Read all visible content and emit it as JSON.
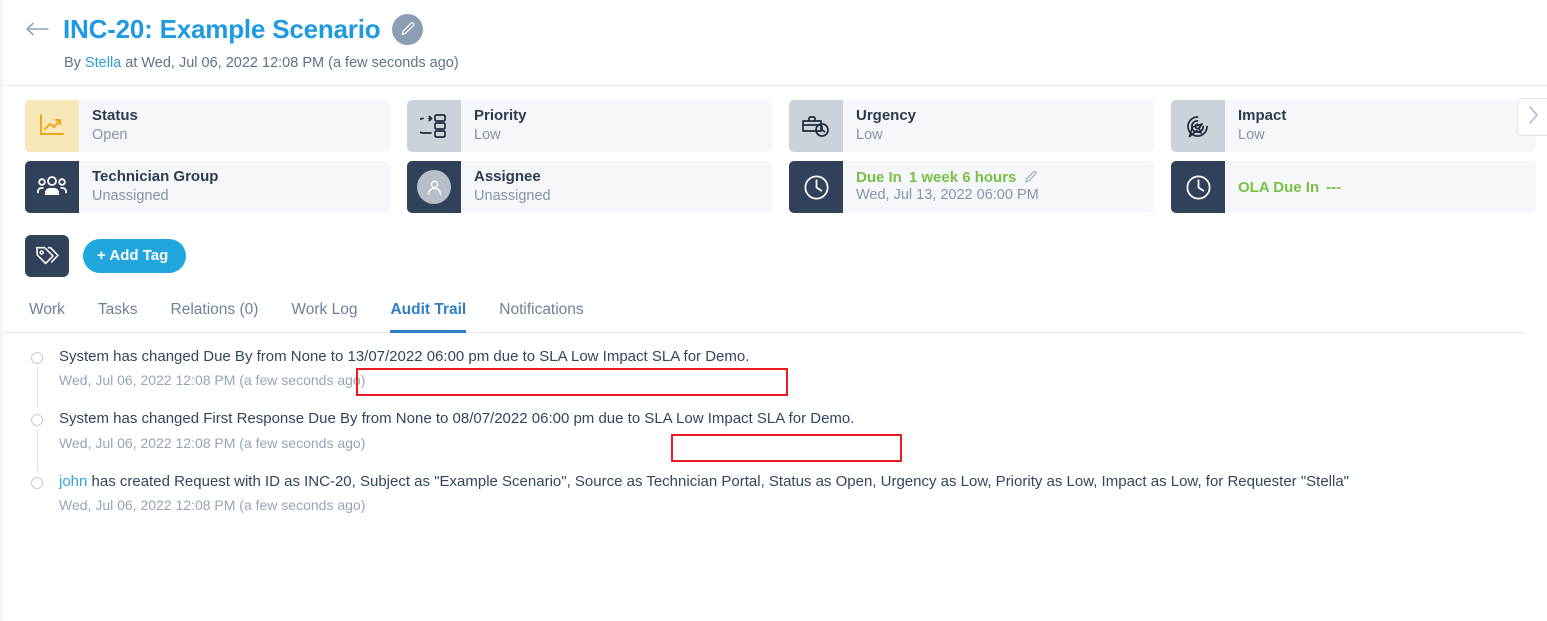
{
  "header": {
    "back_icon": "arrow-left-icon",
    "title": "INC-20: Example Scenario",
    "edit_icon": "pencil-icon",
    "byline_prefix": "By ",
    "byline_user": "Stella",
    "byline_suffix": " at Wed, Jul 06, 2022 12:08 PM (a few seconds ago)"
  },
  "cards": {
    "row1": [
      {
        "label": "Status",
        "value": "Open",
        "icon": "line-chart-icon",
        "icon_style": "yellow"
      },
      {
        "label": "Priority",
        "value": "Low",
        "icon": "priority-flow-icon",
        "icon_style": "grey"
      },
      {
        "label": "Urgency",
        "value": "Low",
        "icon": "briefcase-clock-icon",
        "icon_style": "grey"
      },
      {
        "label": "Impact",
        "value": "Low",
        "icon": "target-arrow-icon",
        "icon_style": "grey"
      }
    ],
    "row2": [
      {
        "label": "Technician Group",
        "value": "Unassigned",
        "icon": "people-group-icon",
        "icon_style": "navy"
      },
      {
        "label": "Assignee",
        "value": "Unassigned",
        "icon": "user-avatar-icon",
        "icon_style": "navy"
      }
    ],
    "due_in": {
      "icon": "clock-icon",
      "label": "Due In",
      "value": "1 week 6 hours",
      "edit_icon": "pencil-icon",
      "subtext": "Wed, Jul 13, 2022 06:00 PM",
      "accent_color": "#79c043"
    },
    "ola_due_in": {
      "icon": "clock-icon",
      "label": "OLA Due In",
      "value": "---",
      "accent_color": "#79c043"
    },
    "next_icon": "chevron-right-icon"
  },
  "tags": {
    "icon": "tag-icon",
    "add_label": "+ Add Tag",
    "add_color": "#21a6de"
  },
  "tabs": [
    {
      "label": "Work",
      "active": false
    },
    {
      "label": "Tasks",
      "active": false
    },
    {
      "label": "Relations (0)",
      "active": false
    },
    {
      "label": "Work Log",
      "active": false
    },
    {
      "label": "Audit Trail",
      "active": true
    },
    {
      "label": "Notifications",
      "active": false
    }
  ],
  "audit_trail": [
    {
      "text": "System has changed Due By from None to 13/07/2022 06:00 pm due to SLA Low Impact SLA for Demo.",
      "time": "Wed, Jul 06, 2022 12:08 PM (a few seconds ago)",
      "actor": ""
    },
    {
      "text": "System has changed First Response Due By from None to 08/07/2022 06:00 pm due to SLA Low Impact SLA for Demo.",
      "time": "Wed, Jul 06, 2022 12:08 PM (a few seconds ago)",
      "actor": ""
    },
    {
      "text": " has created Request with ID as INC-20, Subject as \"Example Scenario\", Source as Technician Portal, Status as Open, Urgency as Low, Priority as Low, Impact as Low, for Requester \"Stella\"",
      "time": "Wed, Jul 06, 2022 12:08 PM (a few seconds ago)",
      "actor": "john"
    }
  ],
  "highlights": {
    "color": "#ec1c24",
    "box1_label": "13/07/2022 06:00 pm due to SLA Low Impact SLA for Demo.",
    "box2_label": "SLA Low Impact SLA for Demo."
  }
}
